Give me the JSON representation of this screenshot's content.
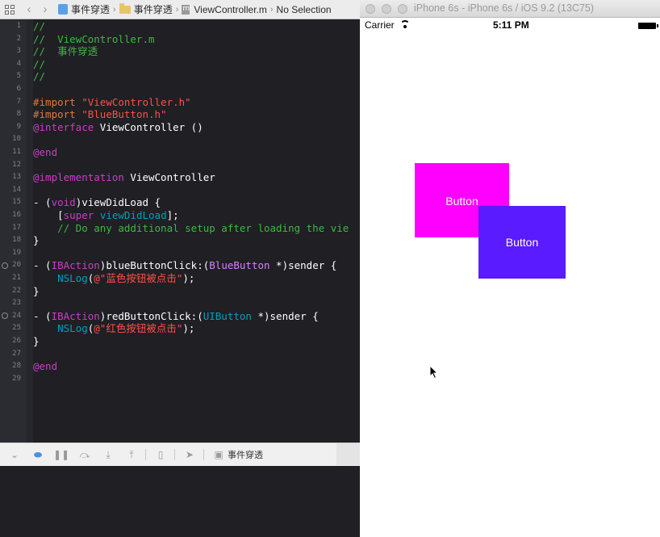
{
  "xcode": {
    "jumpbar": {
      "breadcrumbs": [
        "事件穿透",
        "事件穿透",
        "ViewController.m",
        "No Selection"
      ]
    },
    "lines": [
      [
        {
          "t": "//",
          "c": "comment"
        }
      ],
      [
        {
          "t": "//  ViewController.m",
          "c": "comment"
        }
      ],
      [
        {
          "t": "//  事件穿透",
          "c": "comment"
        }
      ],
      [
        {
          "t": "//",
          "c": "comment"
        }
      ],
      [
        {
          "t": "//",
          "c": "comment"
        }
      ],
      [],
      [
        {
          "t": "#import ",
          "c": "pp"
        },
        {
          "t": "\"ViewController.h\"",
          "c": "str"
        }
      ],
      [
        {
          "t": "#import ",
          "c": "pp"
        },
        {
          "t": "\"BlueButton.h\"",
          "c": "str"
        }
      ],
      [
        {
          "t": "@interface",
          "c": "kw2"
        },
        {
          "t": " ViewController ()",
          "c": "white"
        }
      ],
      [],
      [
        {
          "t": "@end",
          "c": "kw2"
        }
      ],
      [],
      [
        {
          "t": "@implementation",
          "c": "kw2"
        },
        {
          "t": " ViewController",
          "c": "white"
        }
      ],
      [],
      [
        {
          "t": "- (",
          "c": "white"
        },
        {
          "t": "void",
          "c": "kw2"
        },
        {
          "t": ")viewDidLoad {",
          "c": "white"
        }
      ],
      [
        {
          "t": "    [",
          "c": "white"
        },
        {
          "t": "super",
          "c": "kw2"
        },
        {
          "t": " ",
          "c": "white"
        },
        {
          "t": "viewDidLoad",
          "c": "ns"
        },
        {
          "t": "];",
          "c": "white"
        }
      ],
      [
        {
          "t": "    // Do any additional setup after loading the vie",
          "c": "comment"
        }
      ],
      [
        {
          "t": "}",
          "c": "white"
        }
      ],
      [],
      [
        {
          "t": "- (",
          "c": "white"
        },
        {
          "t": "IBAction",
          "c": "kw2"
        },
        {
          "t": ")blueButtonClick:(",
          "c": "white"
        },
        {
          "t": "BlueButton",
          "c": "type"
        },
        {
          "t": " *)sender {",
          "c": "white"
        }
      ],
      [
        {
          "t": "    ",
          "c": "white"
        },
        {
          "t": "NSLog",
          "c": "ns"
        },
        {
          "t": "(",
          "c": "white"
        },
        {
          "t": "@\"蓝色按钮被点击\"",
          "c": "str"
        },
        {
          "t": ");",
          "c": "white"
        }
      ],
      [
        {
          "t": "}",
          "c": "white"
        }
      ],
      [],
      [
        {
          "t": "- (",
          "c": "white"
        },
        {
          "t": "IBAction",
          "c": "kw2"
        },
        {
          "t": ")redButtonClick:(",
          "c": "white"
        },
        {
          "t": "UIButton",
          "c": "ns"
        },
        {
          "t": " *)sender {",
          "c": "white"
        }
      ],
      [
        {
          "t": "    ",
          "c": "white"
        },
        {
          "t": "NSLog",
          "c": "ns"
        },
        {
          "t": "(",
          "c": "white"
        },
        {
          "t": "@\"红色按钮被点击\"",
          "c": "str"
        },
        {
          "t": ");",
          "c": "white"
        }
      ],
      [
        {
          "t": "}",
          "c": "white"
        }
      ],
      [],
      [
        {
          "t": "@end",
          "c": "kw2"
        }
      ],
      []
    ],
    "breakpoint_lines": [
      20,
      24
    ],
    "debugbar": {
      "target_label": "事件穿透"
    }
  },
  "simulator": {
    "title": "iPhone 6s - iPhone 6s / iOS 9.2 (13C75)",
    "statusbar": {
      "carrier": "Carrier",
      "time": "5:11 PM"
    },
    "pink_button_label": "Button",
    "blue_button_label": "Button"
  },
  "colors": {
    "pink_button": "#ff00ff",
    "blue_button": "#5a1bff",
    "editor_bg": "#1f1f24",
    "comment": "#41b645",
    "string": "#ff4f4b",
    "keyword": "#c93fc7"
  }
}
